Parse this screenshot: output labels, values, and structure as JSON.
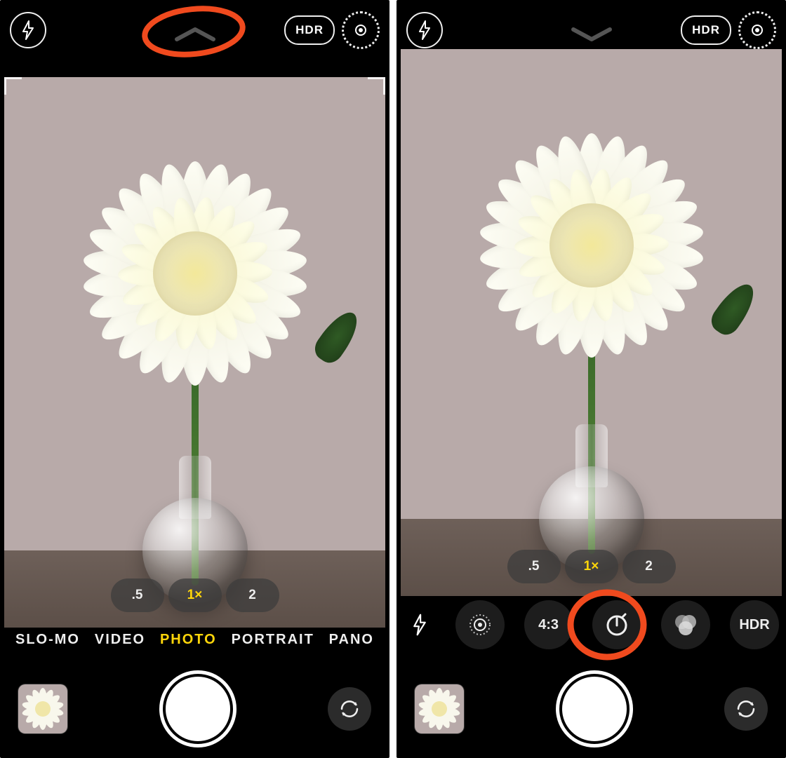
{
  "top": {
    "hdr_label": "HDR"
  },
  "zoom": {
    "wide": ".5",
    "default": "1×",
    "tele": "2"
  },
  "modes": {
    "slomo": "SLO-MO",
    "video": "VIDEO",
    "photo": "PHOTO",
    "portrait": "PORTRAIT",
    "pano": "PANO"
  },
  "options": {
    "aspect": "4:3",
    "hdr": "HDR"
  },
  "icons": {
    "flash": "flash-icon",
    "live": "live-photo-icon",
    "chevron_up": "chevron-up-icon",
    "chevron_down": "chevron-down-icon",
    "timer": "timer-icon",
    "filters": "filters-icon",
    "flip": "flip-camera-icon"
  },
  "annotations": {
    "left_circle": "highlight-chevron",
    "right_circle": "highlight-timer"
  },
  "colors": {
    "accent": "#ffd60a",
    "annotation": "#f04a1e"
  }
}
